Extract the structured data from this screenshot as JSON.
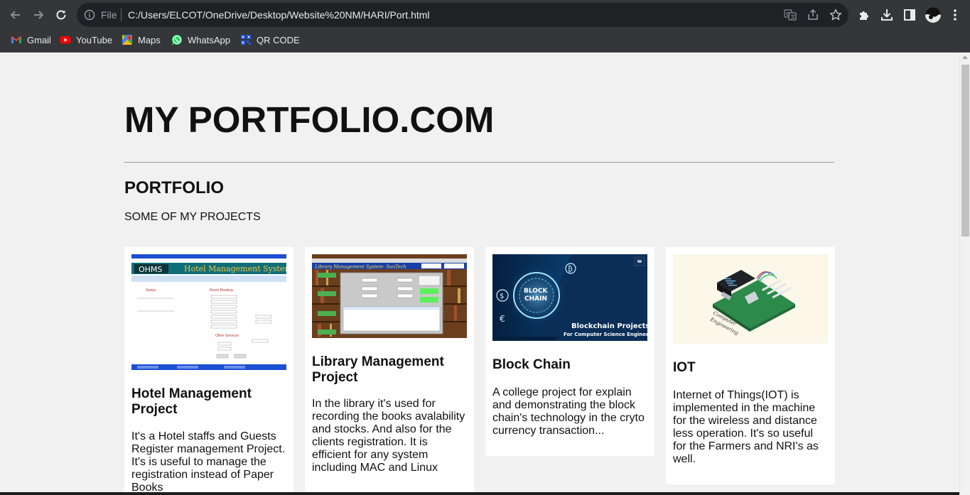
{
  "browser": {
    "file_label": "File",
    "url": "C:/Users/ELCOT/OneDrive/Desktop/Website%20NM/HARI/Port.html",
    "bookmarks": [
      {
        "label": "Gmail",
        "icon": "gmail-icon"
      },
      {
        "label": "YouTube",
        "icon": "youtube-icon"
      },
      {
        "label": "Maps",
        "icon": "maps-icon"
      },
      {
        "label": "WhatsApp",
        "icon": "whatsapp-icon"
      },
      {
        "label": "QR CODE",
        "icon": "qr-code-icon"
      }
    ]
  },
  "page": {
    "title": "MY PORTFOLIO.COM",
    "section_title": "PORTFOLIO",
    "section_subtitle": "SOME OF MY PROJECTS"
  },
  "projects": [
    {
      "title": "Hotel Management Project",
      "description": "It's a Hotel staffs and Guests Register management Project. It's is useful to manage the registration instead of Paper Books",
      "thumb_caption": "Hotel Management System",
      "thumb_logo": "OHMS"
    },
    {
      "title": "Library Management Project",
      "description": "In the library it's used for recording the books avalability and stocks. And also for the clients registration. It is efficient for any system including MAC and Linux",
      "thumb_caption": "Library Management System- SunTech"
    },
    {
      "title": "Block Chain",
      "description": "A college project for explain and demonstrating the block chain's technology in the cryto currency transaction...",
      "thumb_caption": "Blockchain Projects",
      "thumb_caption2": "For Computer Science Engineers",
      "thumb_badge": "BLOCK CHAIN"
    },
    {
      "title": "IOT",
      "description": "Internet of Things(IOT) is implemented in the machine for the wireless and distance less operation. It's so useful for the Farmers and NRI's as well."
    }
  ]
}
